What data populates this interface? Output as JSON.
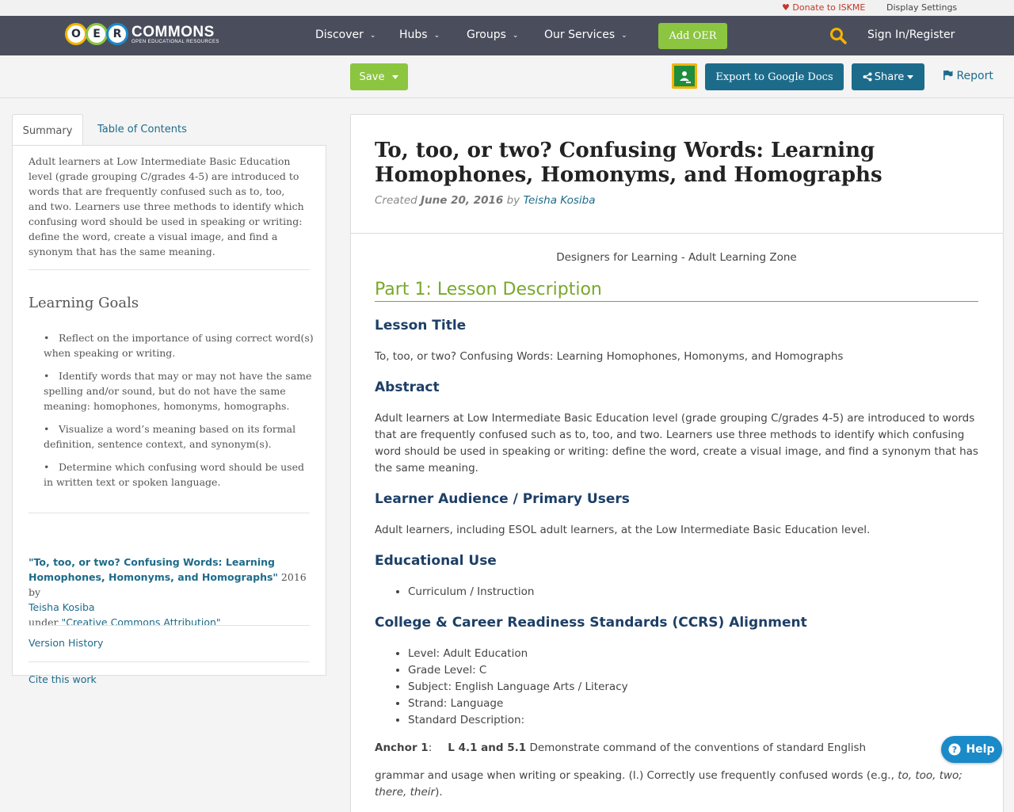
{
  "topbar": {
    "donate": "Donate to ISKME",
    "display_settings": "Display Settings"
  },
  "logo": {
    "letters": [
      "O",
      "E",
      "R"
    ],
    "brand": "COMMONS",
    "tagline": "OPEN EDUCATIONAL RESOURCES"
  },
  "nav": {
    "discover": "Discover",
    "hubs": "Hubs",
    "groups": "Groups",
    "services": "Our Services",
    "add_oer": "Add OER",
    "signin": "Sign In/Register"
  },
  "toolbar": {
    "save": "Save",
    "export": "Export to Google Docs",
    "share": "Share",
    "report": "Report"
  },
  "sidebar": {
    "tab_summary": "Summary",
    "tab_toc": "Table of Contents",
    "summary": "Adult learners at Low Intermediate Basic Education level (grade grouping C/grades 4-5) are introduced to words that are frequently confused such as to, too, and two. Learners use three methods to identify which confusing word should be used in speaking or writing: define the word, create a visual image, and find a synonym that has the same meaning.",
    "goals_heading": "Learning Goals",
    "goals": [
      "Reflect on the importance of using correct word(s) when speaking or writing.",
      "Identify words that may or may not have the same spelling and/or sound, but do not have the same meaning: homophones, homonyms, homographs.",
      "Visualize a word’s meaning based on its formal definition, sentence context, and synonym(s).",
      "Determine which confusing word should be used in written text or spoken language."
    ],
    "attrib_title": "\"To, too, or two? Confusing Words: Learning Homophones, Homonyms, and Homographs\"",
    "attrib_year": " 2016 by",
    "attrib_author": "Teisha Kosiba",
    "attrib_under": "under ",
    "attrib_license": "\"Creative Commons Attribution\"",
    "version_history": "Version History",
    "cite": "Cite this work"
  },
  "main": {
    "title": "To, too, or two? Confusing Words: Learning Homophones, Homonyms, and Homographs",
    "created_label": "Created ",
    "created_date": "June 20, 2016",
    "by": " by ",
    "author": "Teisha Kosiba",
    "designer": "Designers for Learning - Adult Learning Zone",
    "part1": "Part 1: Lesson Description",
    "lesson_title_h": "Lesson Title",
    "lesson_title": "To, too, or two? Confusing Words: Learning Homophones, Homonyms, and Homographs",
    "abstract_h": "Abstract",
    "abstract": "Adult learners at Low Intermediate Basic Education level (grade grouping C/grades 4-5) are introduced to words that are frequently confused such as to, too, and two. Learners use three methods to identify which confusing word should be used in speaking or writing: define the word, create a visual image, and find a synonym that has the same meaning.",
    "audience_h": "Learner Audience / Primary Users",
    "audience": "Adult learners, including ESOL adult learners, at the Low Intermediate Basic Education level.",
    "use_h": "Educational Use",
    "use_items": [
      "Curriculum / Instruction"
    ],
    "ccrs_h": "College & Career Readiness Standards (CCRS) Alignment",
    "ccrs_items": [
      "Level: Adult Education",
      "Grade Level: C",
      "Subject: English Language Arts / Literacy",
      "Strand: Language",
      "Standard Description:"
    ],
    "anchor_label": "Anchor 1",
    "anchor_sep": ":",
    "anchor_code": "L 4.1 and 5.1",
    "anchor_text": " Demonstrate command of the conventions of standard English",
    "grammar_text": "grammar and usage when writing or speaking. (l.) Correctly use frequently confused words (e.g., ",
    "grammar_examples": "to, too, two; there, their",
    "grammar_end": ")."
  },
  "help": {
    "label": "Help"
  },
  "colors": {
    "nav_bg": "#4a4e5c",
    "accent_green": "#8cc540",
    "button_blue": "#1d6b8a",
    "heading_blue": "#1d3f66",
    "part_green": "#7aa82c",
    "help_blue": "#1a8ac9"
  }
}
